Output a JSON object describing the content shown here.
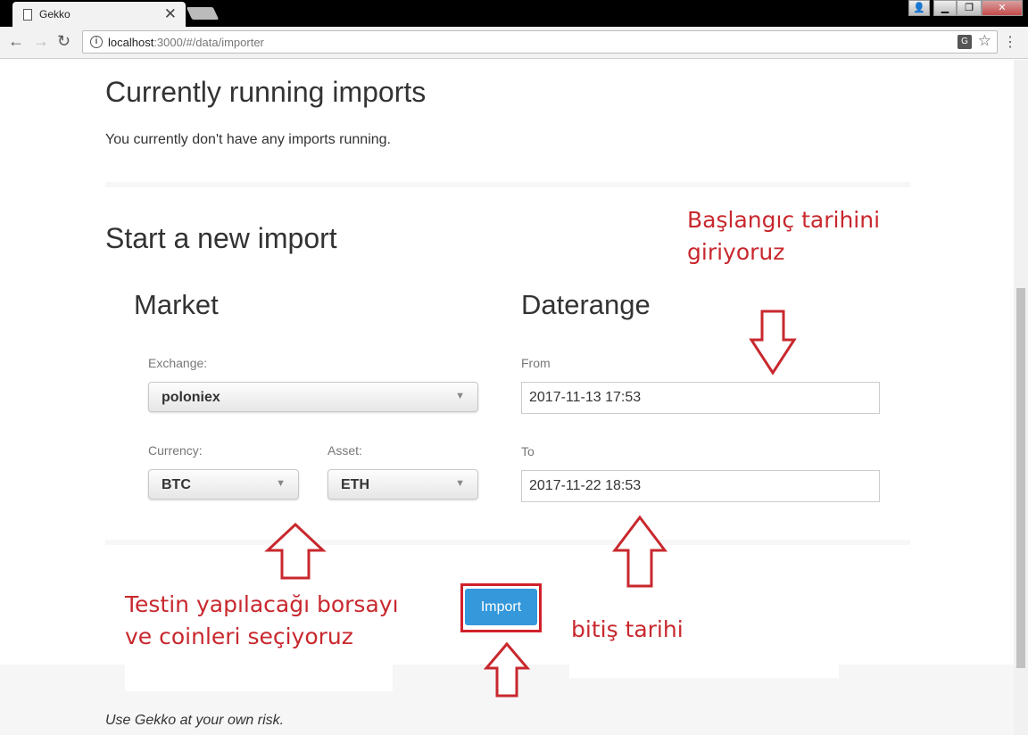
{
  "browser": {
    "tab_title": "Gekko",
    "tab_close": "✕",
    "url_host": "localhost",
    "url_path": ":3000/#/data/importer",
    "window_controls": {
      "minimize": "▁",
      "restore": "❐",
      "close": "✕"
    }
  },
  "running": {
    "title": "Currently running imports",
    "message": "You currently don't have any imports running."
  },
  "new_import": {
    "title": "Start a new import",
    "market": {
      "title": "Market",
      "exchange_label": "Exchange:",
      "exchange_value": "poloniex",
      "currency_label": "Currency:",
      "currency_value": "BTC",
      "asset_label": "Asset:",
      "asset_value": "ETH"
    },
    "daterange": {
      "title": "Daterange",
      "from_label": "From",
      "from_value": "2017-11-13 17:53",
      "to_label": "To",
      "to_value": "2017-11-22 18:53"
    },
    "import_label": "Import"
  },
  "footer": {
    "text": "Use Gekko at your own risk."
  },
  "annotations": {
    "start_date_line1": "Başlangıç tarihini",
    "start_date_line2": "giriyoruz",
    "exchange_line1": "Testin yapılacağı borsayı",
    "exchange_line2": "ve coinleri seçiyoruz",
    "end_date": "bitiş tarihi"
  },
  "colors": {
    "annotation": "#c8282e",
    "button": "#3498db"
  }
}
